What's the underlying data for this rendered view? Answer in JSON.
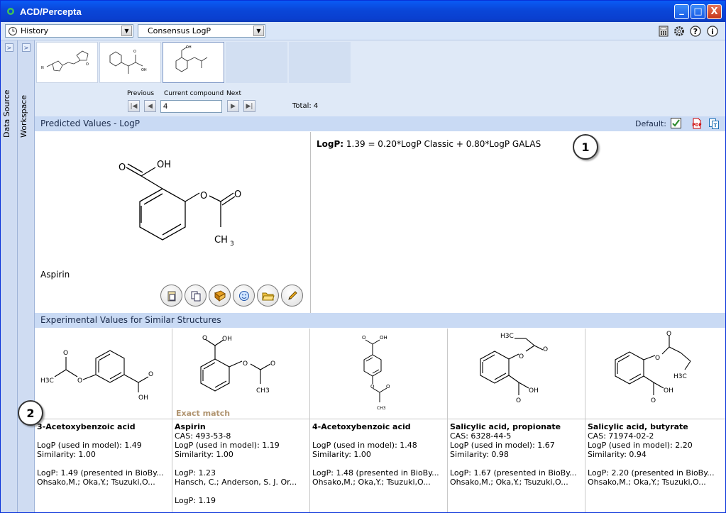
{
  "window": {
    "title": "ACD/Percepta",
    "minimize": "_",
    "maximize": "□",
    "close": "X"
  },
  "toolbar": {
    "history_label": "History",
    "module_label": "Consensus LogP"
  },
  "sidebar": {
    "data_source": "Data Source",
    "workspace": "Workspace"
  },
  "navigator": {
    "previous": "Previous",
    "current": "Current compound",
    "next": "Next",
    "current_value": "4",
    "total": "Total: 4"
  },
  "predicted": {
    "header": "Predicted Values - LogP",
    "default_label": "Default:",
    "compound_name": "Aspirin",
    "formula_label": "LogP:",
    "formula_text": "1.39 = 0.20*LogP Classic + 0.80*LogP GALAS"
  },
  "experimental": {
    "header": "Experimental Values for Similar Structures",
    "exact_match": "Exact match",
    "items": [
      {
        "name": "3-Acetoxybenzoic acid",
        "cas": "",
        "logp_model": "LogP (used in model): 1.49",
        "similarity": "Similarity: 1.00",
        "logp_ref": "LogP: 1.49 (presented in BioBy...",
        "authors": "Ohsako,M.; Oka,Y.; Tsuzuki,O...",
        "logp_extra": ""
      },
      {
        "name": "Aspirin",
        "cas": "CAS: 493-53-8",
        "logp_model": "LogP (used in model): 1.19",
        "similarity": "Similarity: 1.00",
        "logp_ref": "LogP: 1.23",
        "authors": "Hansch, C.; Anderson, S. J. Or...",
        "logp_extra": "LogP: 1.19"
      },
      {
        "name": "4-Acetoxybenzoic acid",
        "cas": "",
        "logp_model": "LogP (used in model): 1.48",
        "similarity": "Similarity: 1.00",
        "logp_ref": "LogP: 1.48 (presented in BioBy...",
        "authors": "Ohsako,M.; Oka,Y.; Tsuzuki,O...",
        "logp_extra": ""
      },
      {
        "name": "Salicylic acid, propionate",
        "cas": "CAS: 6328-44-5",
        "logp_model": "LogP (used in model): 1.67",
        "similarity": "Similarity: 0.98",
        "logp_ref": "LogP: 1.67 (presented in BioBy...",
        "authors": "Ohsako,M.; Oka,Y.; Tsuzuki,O...",
        "logp_extra": ""
      },
      {
        "name": "Salicylic acid, butyrate",
        "cas": "CAS: 71974-02-2",
        "logp_model": "LogP (used in model): 2.20",
        "similarity": "Similarity: 0.94",
        "logp_ref": "LogP: 2.20 (presented in BioBy...",
        "authors": "Ohsako,M.; Oka,Y.; Tsuzuki,O...",
        "logp_extra": ""
      }
    ]
  },
  "callouts": {
    "one": "1",
    "two": "2"
  },
  "icons": {
    "history": "clock-icon",
    "calculator": "calculator-icon",
    "settings": "gear-icon",
    "help": "help-icon",
    "info": "info-icon",
    "pdf": "pdf-icon",
    "copy": "copy-icon"
  },
  "colors": {
    "titlebar": "#0a46d8",
    "section_header": "#c9daf4",
    "exact_match": "#b09470",
    "default_check": "#2e8b2e"
  }
}
